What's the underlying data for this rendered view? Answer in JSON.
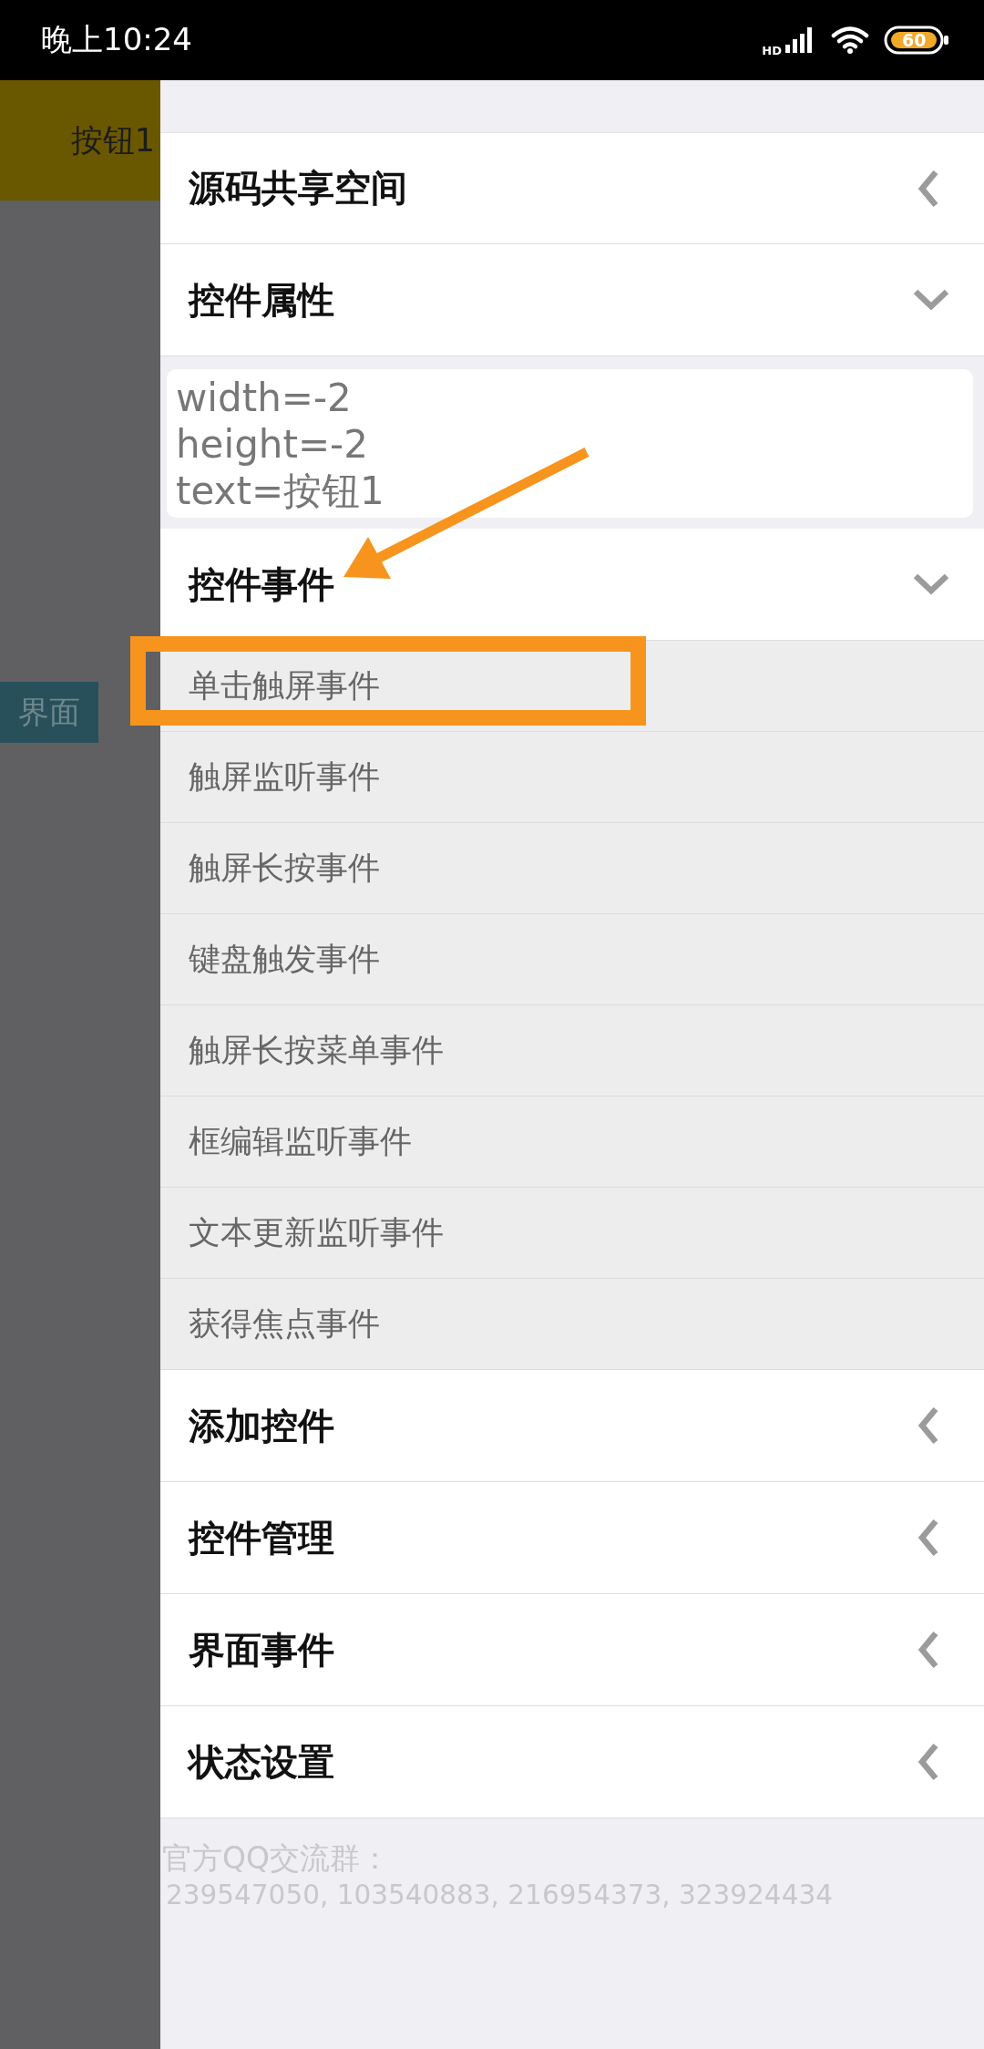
{
  "status_bar": {
    "time": "晚上10:24",
    "network_type": "HD",
    "battery": "60"
  },
  "canvas": {
    "button": {
      "text": "按钮1"
    },
    "tab": {
      "text": "界面"
    }
  },
  "sections": [
    {
      "title": "源码共享空间",
      "expanded": false,
      "arrow_annotation": false
    },
    {
      "title": "控件属性",
      "kind": "properties",
      "expanded": true,
      "arrow_annotation": false,
      "properties": "width=-2\nheight=-2\ntext=按钮1"
    },
    {
      "title": "控件事件",
      "kind": "events",
      "expanded": true,
      "arrow_annotation": true,
      "items": [
        {
          "label": "单击触屏事件",
          "highlighted": true
        },
        {
          "label": "触屏监听事件",
          "highlighted": false
        },
        {
          "label": "触屏长按事件",
          "highlighted": false
        },
        {
          "label": "键盘触发事件",
          "highlighted": false
        },
        {
          "label": "触屏长按菜单事件",
          "highlighted": false
        },
        {
          "label": "框编辑监听事件",
          "highlighted": false
        },
        {
          "label": "文本更新监听事件",
          "highlighted": false
        },
        {
          "label": "获得焦点事件",
          "highlighted": false
        }
      ]
    },
    {
      "title": "添加控件",
      "expanded": false,
      "arrow_annotation": false
    },
    {
      "title": "控件管理",
      "expanded": false,
      "arrow_annotation": false
    },
    {
      "title": "界面事件",
      "expanded": false,
      "arrow_annotation": false
    },
    {
      "title": "状态设置",
      "expanded": false,
      "arrow_annotation": false
    }
  ],
  "footer": {
    "label": "官方QQ交流群：",
    "groups": "239547050, 103540883, 216954373, 323924434"
  }
}
